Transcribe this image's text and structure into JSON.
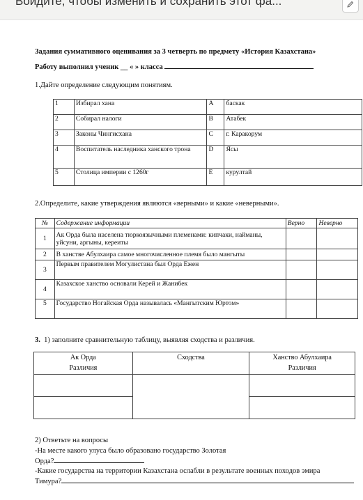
{
  "banner": {
    "text": "Войдите, чтобы изменить и сохранить этот фа...",
    "icon": "pencil-icon"
  },
  "header": {
    "title": "Задания суммативного оценивания за 3 четверть по предмету «История Казахстана»",
    "student_prefix": "Работу выполнил ученик __ « » класса"
  },
  "task1": {
    "heading": "1.Дайте определение следующим понятиям.",
    "rows": [
      {
        "n": "1",
        "term": "Избирал хана",
        "letter": "A",
        "answer": "баскак"
      },
      {
        "n": "2",
        "term": "Собирал налоги",
        "letter": "B",
        "answer": "Атабек"
      },
      {
        "n": "3",
        "term": "Законы Чингисхана",
        "letter": "C",
        "answer": "г. Каракорум"
      },
      {
        "n": "4",
        "term": "Воспитатель наследника ханского трона",
        "letter": "D",
        "answer": "Ясы"
      },
      {
        "n": "5",
        "term": "Столица империи с 1260г",
        "letter": "E",
        "answer": "курултай"
      }
    ]
  },
  "task2": {
    "heading": "2.Определите, какие утверждения являются «верными» и какие «неверными».",
    "col_n": "№",
    "col_content": "Содержание информации",
    "col_true": "Верно",
    "col_false": "Неверно",
    "rows": [
      {
        "n": "1",
        "text": "Ак Орда была населена тюркоязычными племенами: кипчаки, найманы, уйсуни, аргыны, кереиты"
      },
      {
        "n": "2",
        "text": "В ханстве Абулхаира самое многочисленное племя было мангыты"
      },
      {
        "n": "3",
        "text": "Первым правителем Могулистана  был Орда Ежен"
      },
      {
        "n": "4",
        "text": "Казахское ханство основали Керей и Жанибек"
      },
      {
        "n": "5",
        "text": "Государство Ногайская Орда называлась «Мангытским Юртом»"
      }
    ]
  },
  "task3": {
    "num": "3.",
    "heading": "1) заполните сравнительную таблицу, выявляя сходства и различия.",
    "col1_line1": "Ак Орда",
    "col1_line2": "Различия",
    "col2": "Сходства",
    "col3_line1": "Ханство Абулхаира",
    "col3_line2": "Различия"
  },
  "task4": {
    "heading": "2) Ответьте на вопросы",
    "q1_line1": "-На месте  какого улуса было образовано государство Золотая",
    "q1_line2": "Орда?",
    "q2_line1": "-Какие государства  на территории Казахстана ослабли в результате военных походов эмира",
    "q2_line2": "Тимура?"
  }
}
